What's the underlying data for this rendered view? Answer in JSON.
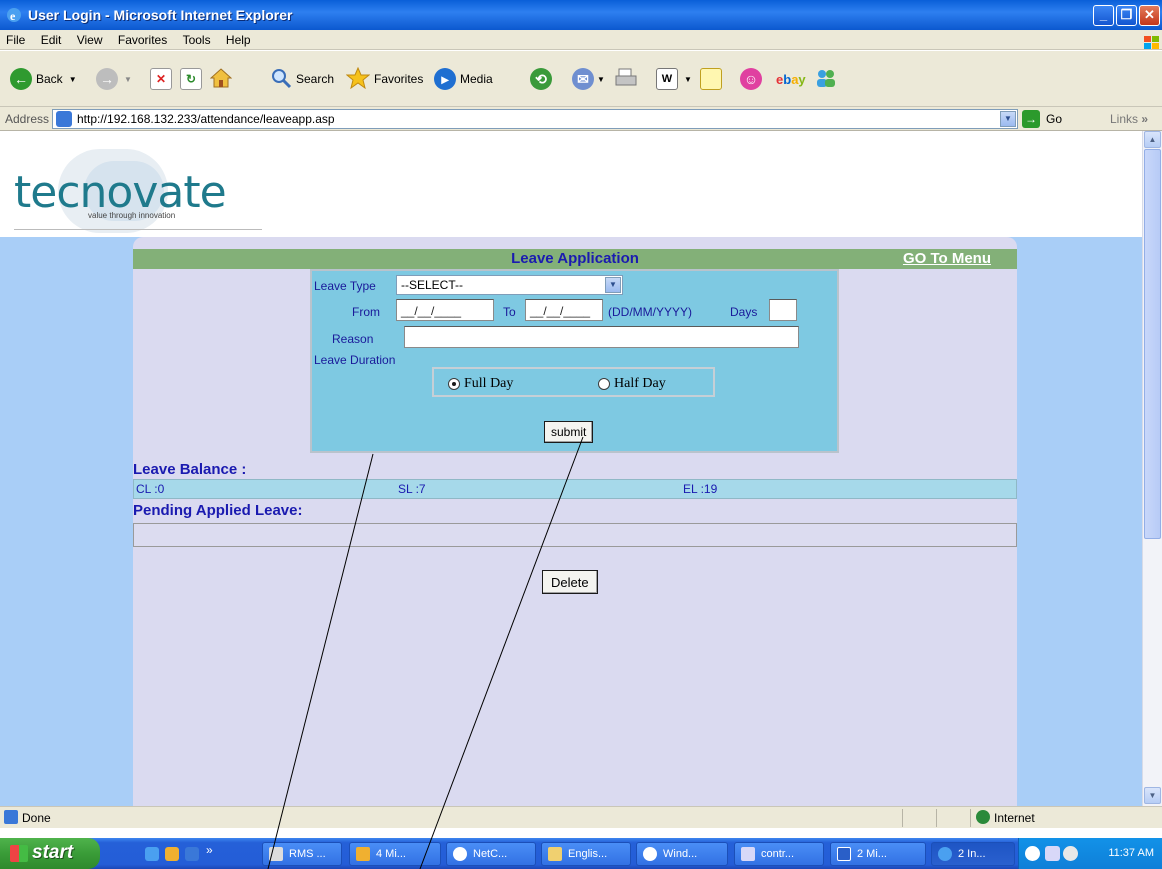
{
  "window": {
    "title": "User Login - Microsoft Internet Explorer"
  },
  "menu": [
    "File",
    "Edit",
    "View",
    "Favorites",
    "Tools",
    "Help"
  ],
  "toolbar": {
    "back": "Back",
    "search": "Search",
    "favorites": "Favorites",
    "media": "Media"
  },
  "address": {
    "label": "Address",
    "url": "http://192.168.132.233/attendance/leaveapp.asp",
    "go": "Go",
    "links": "Links"
  },
  "logo": {
    "word": "tecnovate",
    "tagline": "value through innovation"
  },
  "form": {
    "title": "Leave Application",
    "menu_link": "GO To Menu",
    "leave_type_label": "Leave Type",
    "leave_type_value": "--SELECT--",
    "from_label": "From",
    "from_value": "__/__/____",
    "to_label": "To",
    "to_value": "__/__/____",
    "date_format": "(DD/MM/YYYY)",
    "days_label": "Days",
    "days_value": "",
    "reason_label": "Reason",
    "reason_value": "",
    "duration_label": "Leave Duration",
    "full_day": "Full Day",
    "half_day": "Half Day",
    "selected_duration": "full",
    "submit": "submit"
  },
  "balance": {
    "title": "Leave Balance :",
    "cl": "CL :0",
    "sl": "SL :7",
    "el": "EL :19"
  },
  "pending": {
    "title": "Pending Applied Leave:"
  },
  "delete_label": "Delete",
  "status": {
    "text": "Done",
    "zone": "Internet"
  },
  "taskbar": {
    "start": "start",
    "items": [
      "RMS ...",
      "4 Mi...",
      "NetC...",
      "Englis...",
      "Wind...",
      "contr...",
      "2 Mi...",
      "2 In..."
    ],
    "clock": "11:37 AM"
  }
}
